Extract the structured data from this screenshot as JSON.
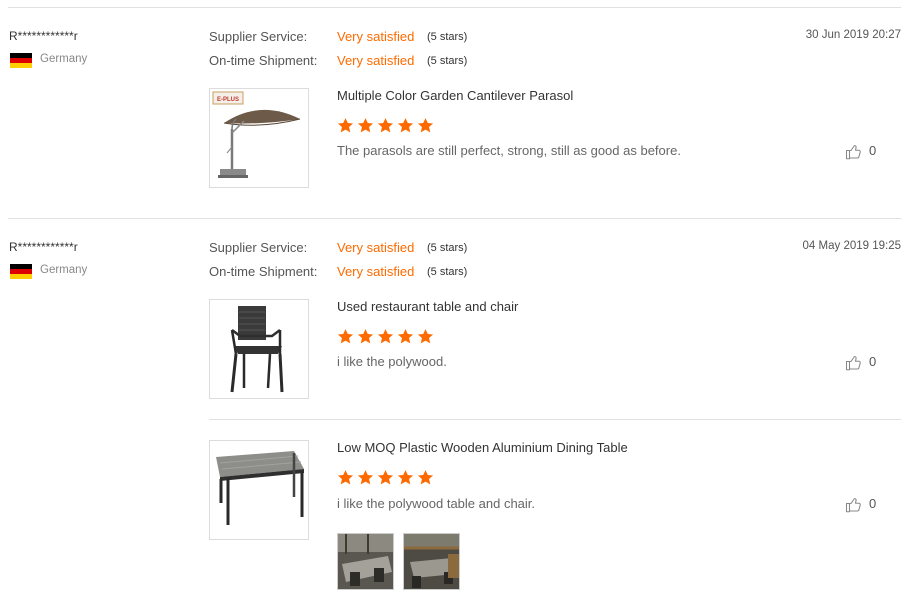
{
  "reviews": [
    {
      "reviewer": "R************r",
      "country": "Germany",
      "supplier_label": "Supplier Service:",
      "supplier_value": "Very satisfied",
      "supplier_stars": "(5 stars)",
      "shipment_label": "On-time Shipment:",
      "shipment_value": "Very satisfied",
      "shipment_stars": "(5 stars)",
      "date": "30 Jun 2019 20:27",
      "products": [
        {
          "title": "Multiple Color Garden Cantilever Parasol",
          "rating": 5,
          "comment": "The parasols are still perfect, strong, still as good as before.",
          "likes": "0",
          "thumb_logo": "E-PLUS"
        }
      ]
    },
    {
      "reviewer": "R************r",
      "country": "Germany",
      "supplier_label": "Supplier Service:",
      "supplier_value": "Very satisfied",
      "supplier_stars": "(5 stars)",
      "shipment_label": "On-time Shipment:",
      "shipment_value": "Very satisfied",
      "shipment_stars": "(5 stars)",
      "date": "04 May 2019 19:25",
      "products": [
        {
          "title": "Used restaurant table and chair",
          "rating": 5,
          "comment": "i like the polywood.",
          "likes": "0"
        },
        {
          "title": "Low MOQ Plastic Wooden Aluminium Dining Table",
          "rating": 5,
          "comment": "i like the polywood table and chair.",
          "likes": "0"
        }
      ]
    }
  ],
  "colors": {
    "accent": "#ff6a00",
    "divider": "#e1e1e1",
    "flag_black": "#000000",
    "flag_red": "#dd0000",
    "flag_gold": "#ffce00"
  },
  "icons": {
    "star": "star-icon",
    "like": "thumbs-up-icon",
    "flag": "germany-flag-icon"
  }
}
